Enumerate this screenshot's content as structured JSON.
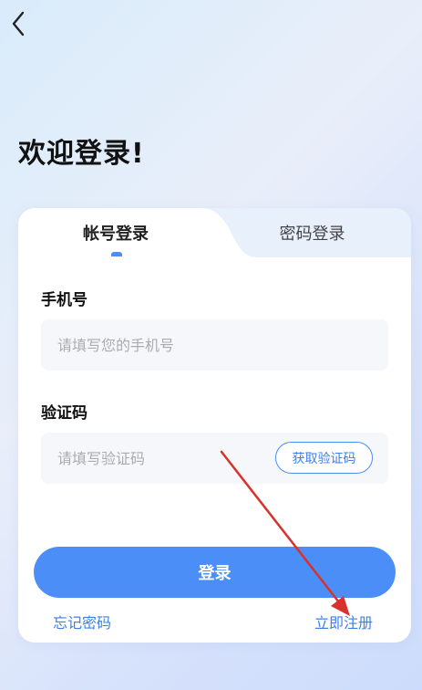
{
  "header": {
    "back_icon": "chevron-left-icon"
  },
  "welcome_title": "欢迎登录!",
  "tabs": [
    {
      "label": "帐号登录",
      "active": true
    },
    {
      "label": "密码登录",
      "active": false
    }
  ],
  "form": {
    "phone_label": "手机号",
    "phone_placeholder": "请填写您的手机号",
    "phone_value": "",
    "code_label": "验证码",
    "code_placeholder": "请填写验证码",
    "code_value": "",
    "get_code_label": "获取验证码"
  },
  "login_label": "登录",
  "links": {
    "forgot_password": "忘记密码",
    "register": "立即注册"
  },
  "colors": {
    "accent": "#4b8ef7",
    "link": "#3f7fe8",
    "annotation_arrow": "#d9312b"
  }
}
